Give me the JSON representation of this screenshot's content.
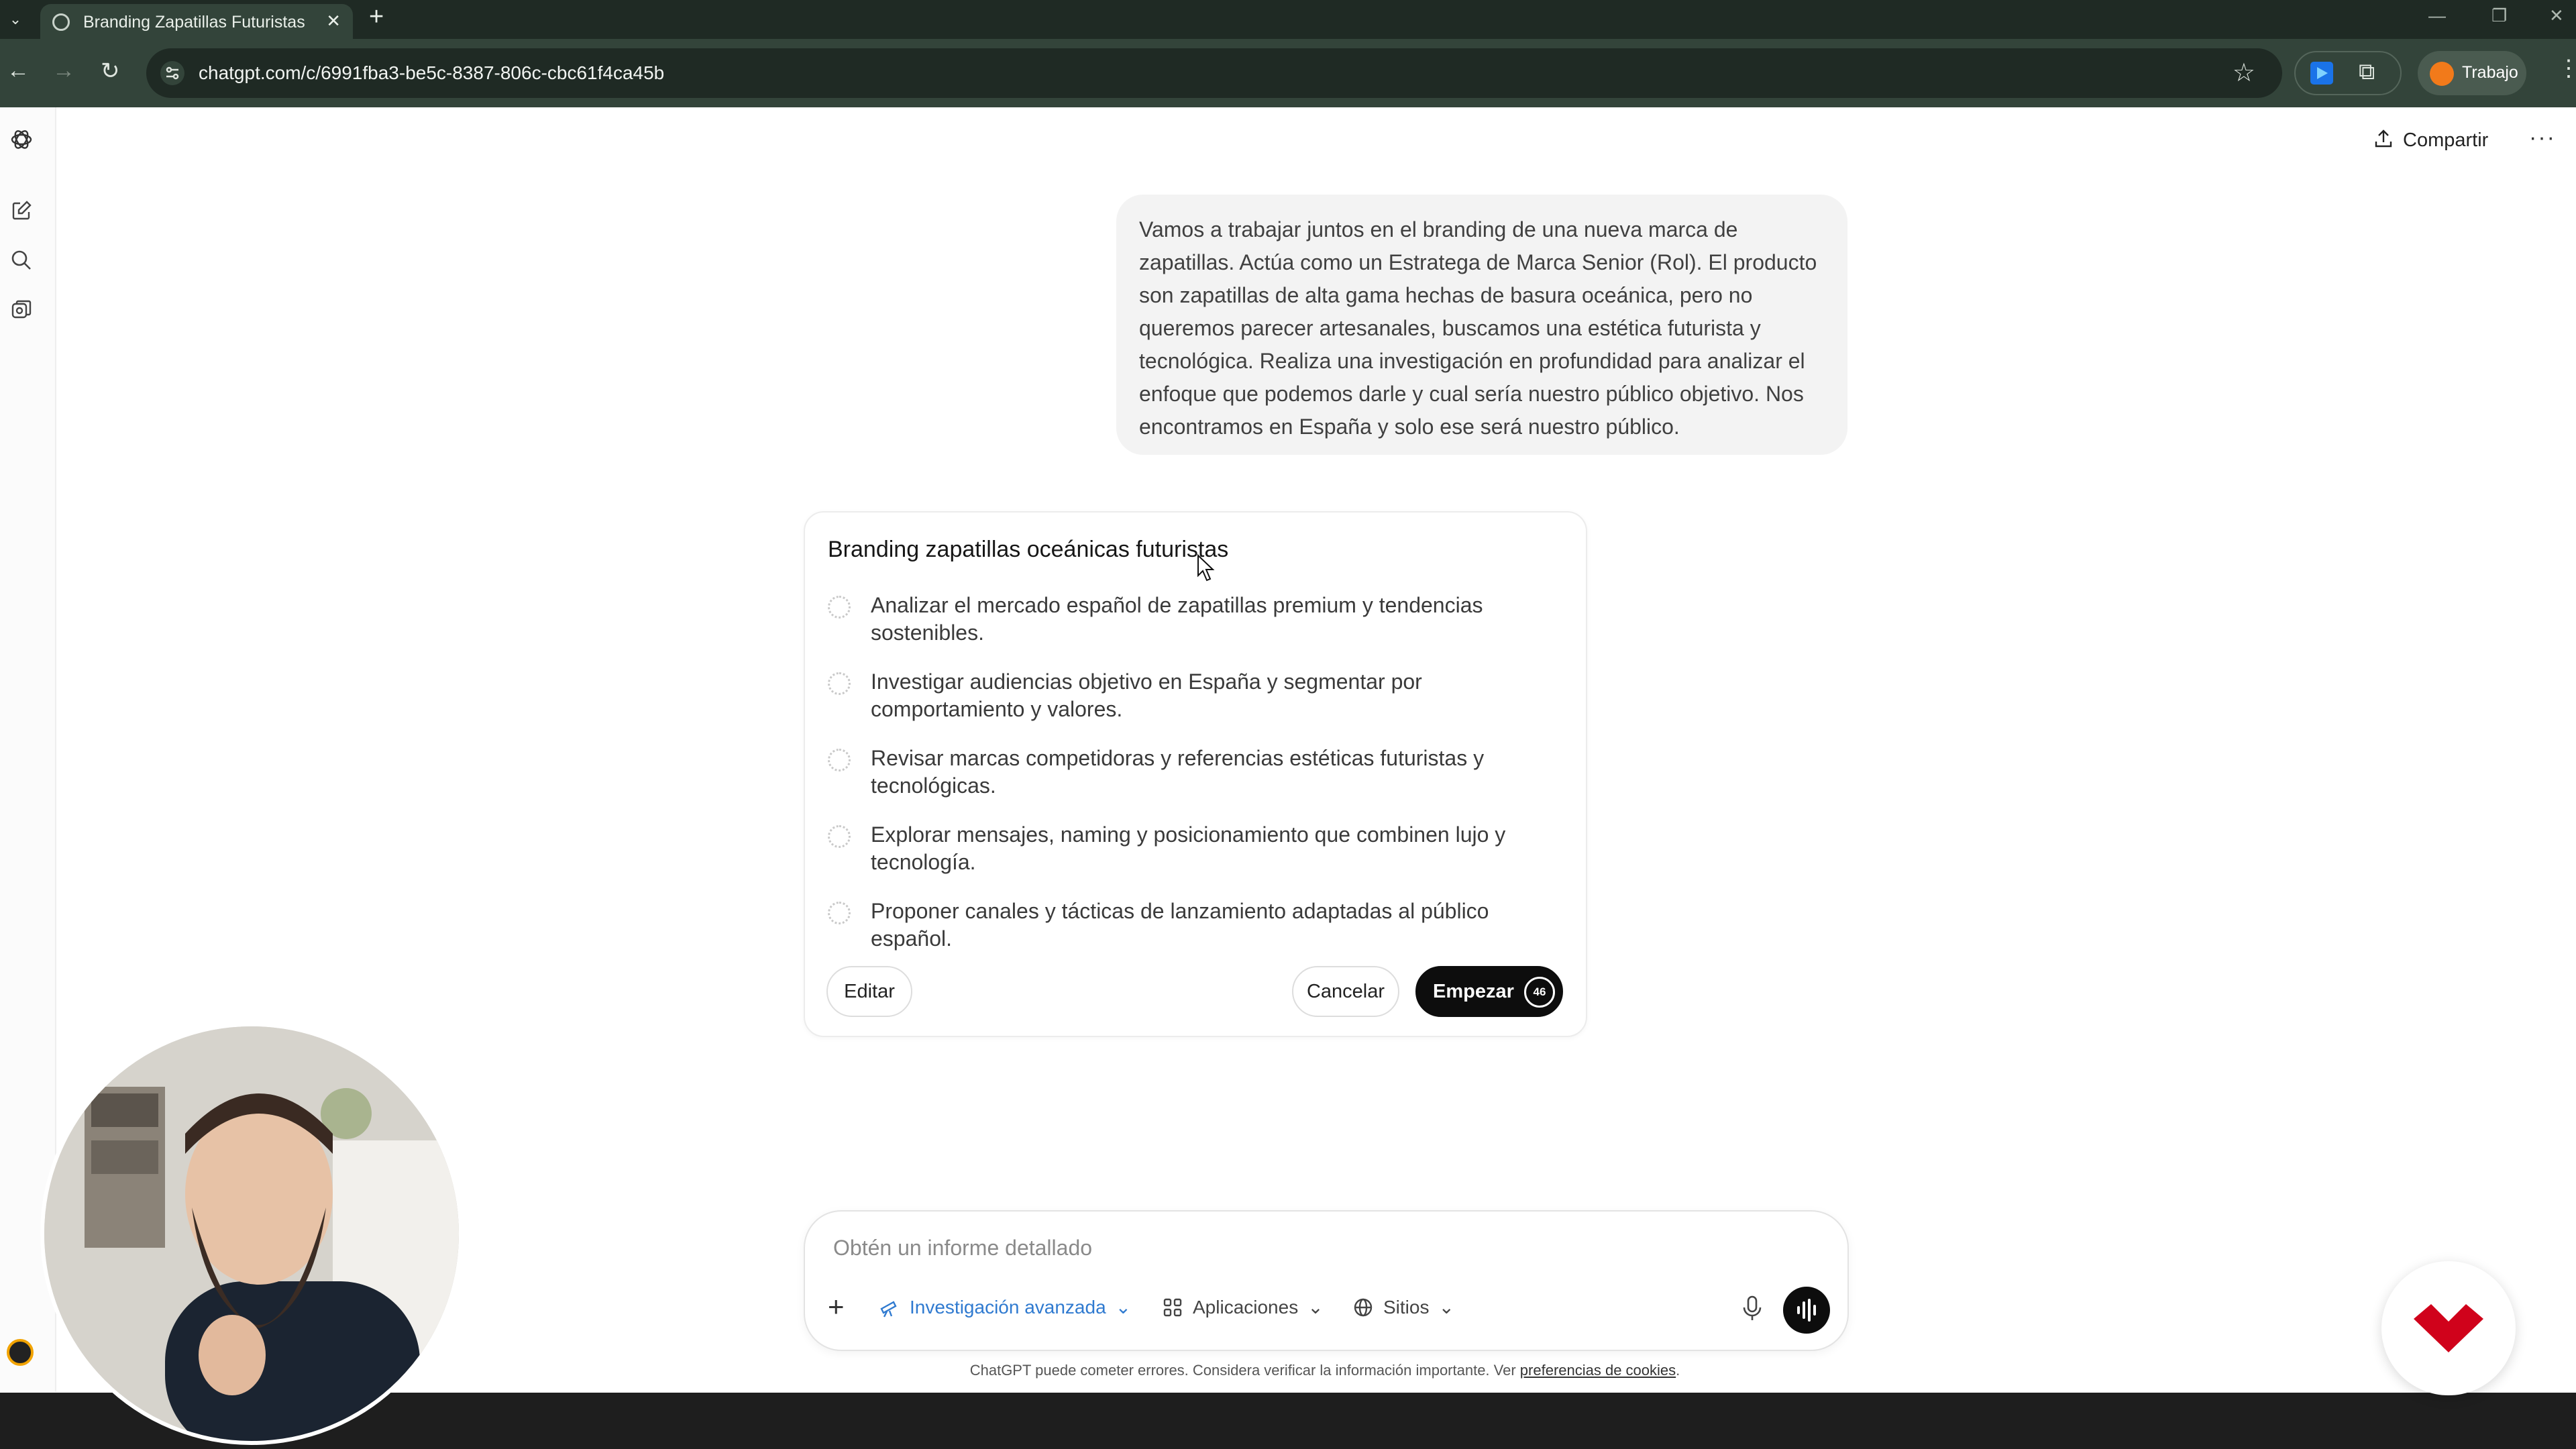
{
  "browser": {
    "tab_title": "Branding Zapatillas Futuristas",
    "url": "chatgpt.com/c/6991fba3-be5c-8387-806c-cbc61f4ca45b",
    "profile_name": "Trabajo"
  },
  "header": {
    "share_label": "Compartir"
  },
  "user_message": "Vamos a trabajar juntos en el branding de una nueva marca de zapatillas. Actúa como un Estratega de Marca Senior (Rol). El producto son zapatillas de alta gama hechas de basura oceánica, pero no queremos parecer artesanales, buscamos una estética futurista y tecnológica. Realiza una investigación en profundidad para analizar el enfoque que podemos darle y cual sería nuestro público objetivo. Nos encontramos en España y solo ese será nuestro público.",
  "plan": {
    "title": "Branding zapatillas oceánicas futuristas",
    "steps": [
      "Analizar el mercado español de zapatillas premium y tendencias sostenibles.",
      "Investigar audiencias objetivo en España y segmentar por comportamiento y valores.",
      "Revisar marcas competidoras y referencias estéticas futuristas y tecnológicas.",
      "Explorar mensajes, naming y posicionamiento que combinen lujo y tecnología.",
      "Proponer canales y tácticas de lanzamiento adaptadas al público español."
    ],
    "edit_label": "Editar",
    "cancel_label": "Cancelar",
    "start_label": "Empezar",
    "countdown": "46"
  },
  "composer": {
    "placeholder": "Obtén un informe detallado",
    "mode_label": "Investigación avanzada",
    "apps_label": "Aplicaciones",
    "sites_label": "Sitios"
  },
  "footer": {
    "disclaimer": "ChatGPT puede cometer errores. Considera verificar la información importante. Ver ",
    "cookies_link": "preferencias de cookies",
    "disclaimer_end": "."
  },
  "colors": {
    "browser_frame": "#33443a",
    "accent_blue": "#2f7ad0",
    "brand_red": "#d0021b",
    "profile_orange": "#f27a1a"
  }
}
